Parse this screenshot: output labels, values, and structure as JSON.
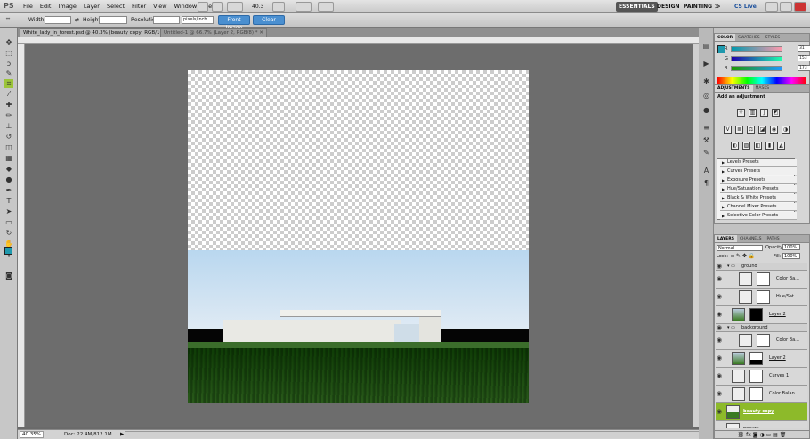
{
  "app": {
    "logo": "PS"
  },
  "menu": [
    "File",
    "Edit",
    "Image",
    "Layer",
    "Select",
    "Filter",
    "View",
    "Window",
    "Help"
  ],
  "zoom_menu": "40.3",
  "workspaces": {
    "essentials": "ESSENTIALS",
    "design": "DESIGN",
    "painting": "PAINTING",
    "more": "≫",
    "cslive": "CS Live"
  },
  "options": {
    "width_label": "Width:",
    "height_label": "Height:",
    "resolution_label": "Resolution:",
    "units": "pixels/inch",
    "front_image": "Front Image",
    "clear": "Clear"
  },
  "tabs": [
    {
      "label": "White_lady_in_forest.psd @ 40.3% (beauty copy, RGB/16) *"
    },
    {
      "label": "Untitled-1 @ 66.7% (Layer 2, RGB/8) *"
    }
  ],
  "status": {
    "zoom": "40.35%",
    "doc": "Doc: 22.4M/812.1M"
  },
  "color_panel": {
    "tabs": [
      "COLOR",
      "SWATCHES",
      "STYLES"
    ],
    "r_label": "R",
    "g_label": "G",
    "b_label": "B",
    "r": "31",
    "g": "153",
    "b": "173",
    "fg_color": "#1f99ad"
  },
  "adjustments": {
    "tabs": [
      "ADJUSTMENTS",
      "MASKS"
    ],
    "heading": "Add an adjustment",
    "presets": [
      "Levels Presets",
      "Curves Presets",
      "Exposure Presets",
      "Hue/Saturation Presets",
      "Black & White Presets",
      "Channel Mixer Presets",
      "Selective Color Presets"
    ]
  },
  "layers": {
    "tabs": [
      "LAYERS",
      "CHANNELS",
      "PATHS"
    ],
    "blend": "Normal",
    "opacity_label": "Opacity:",
    "opacity": "100%",
    "lock_label": "Lock:",
    "fill_label": "Fill:",
    "fill": "100%",
    "group_ground": "ground",
    "group_background": "background",
    "rows": [
      {
        "name": "Color Ba..."
      },
      {
        "name": "Hue/Sat..."
      },
      {
        "name": "Layer 2"
      },
      {
        "name": "Color Ba..."
      },
      {
        "name": "Layer 2"
      },
      {
        "name": "Curves 1"
      },
      {
        "name": "Color Balan..."
      },
      {
        "name": "beauty copy"
      },
      {
        "name": "beauty"
      }
    ]
  }
}
